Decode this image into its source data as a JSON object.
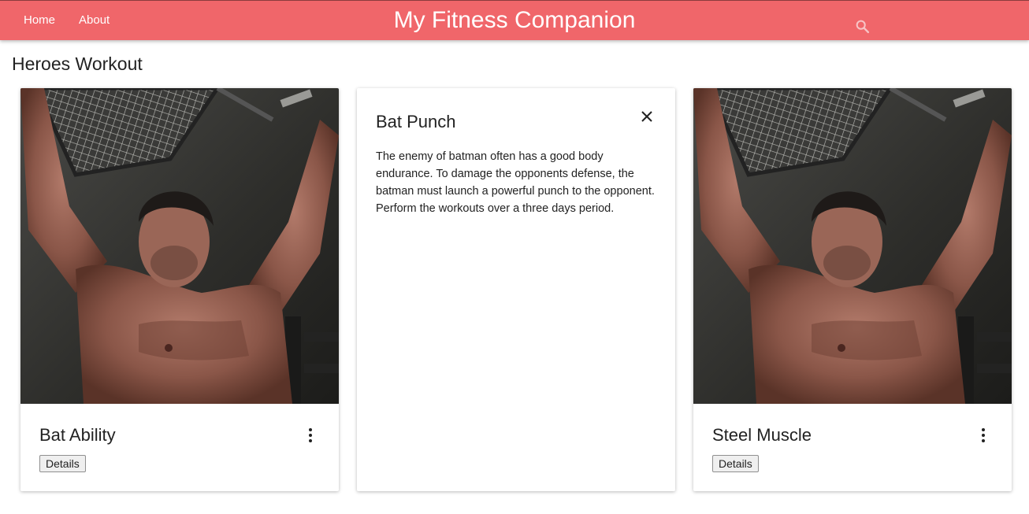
{
  "nav": {
    "home_label": "Home",
    "about_label": "About",
    "title": "My Fitness Companion",
    "search_icon": "search-icon",
    "bar_color": "#f0666a"
  },
  "page": {
    "section_title": "Heroes Workout"
  },
  "cards": [
    {
      "title": "Bat Ability",
      "details_label": "Details",
      "menu_icon": "more-vert-icon",
      "image": "workout-photo"
    },
    {
      "reveal_title": "Bat Punch",
      "reveal_text": "The enemy of batman often has a good body endurance. To damage the opponents defense, the batman must launch a powerful punch to the opponent. Perform the workouts over a three days period.",
      "close_icon": "close-icon"
    },
    {
      "title": "Steel Muscle",
      "details_label": "Details",
      "menu_icon": "more-vert-icon",
      "image": "workout-photo"
    }
  ]
}
